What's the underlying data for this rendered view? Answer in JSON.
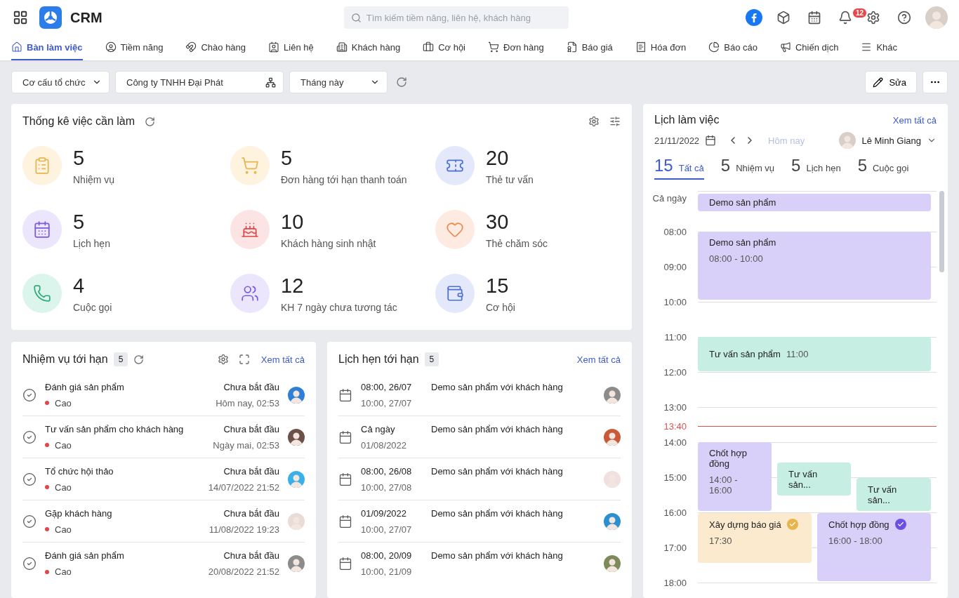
{
  "header": {
    "app_name": "CRM",
    "search": {
      "placeholder": "Tìm kiếm tiềm năng, liên hệ, khách hàng"
    },
    "notifications": "12"
  },
  "nav": [
    {
      "label": "Bàn làm việc",
      "kind": "home",
      "selected": true
    },
    {
      "label": "Tiềm năng",
      "kind": "lead",
      "selected": false
    },
    {
      "label": "Chào hàng",
      "kind": "magnet",
      "selected": false
    },
    {
      "label": "Liên hệ",
      "kind": "contact",
      "selected": false
    },
    {
      "label": "Khách hàng",
      "kind": "building",
      "selected": false
    },
    {
      "label": "Cơ hội",
      "kind": "wallet",
      "selected": false
    },
    {
      "label": "Đơn hàng",
      "kind": "cart",
      "selected": false
    },
    {
      "label": "Báo giá",
      "kind": "quote",
      "selected": false
    },
    {
      "label": "Hóa đơn",
      "kind": "invoice",
      "selected": false
    },
    {
      "label": "Báo cáo",
      "kind": "report",
      "selected": false
    },
    {
      "label": "Chiến dịch",
      "kind": "campaign",
      "selected": false
    },
    {
      "label": "Khác",
      "kind": "more",
      "selected": false
    }
  ],
  "filters": {
    "org": "Cơ cấu tổ chức",
    "company": "Công ty TNHH Đại Phát",
    "period": "Tháng này",
    "edit": "Sửa"
  },
  "stats": {
    "title": "Thống kê việc cần làm",
    "items": [
      {
        "value": "5",
        "label": "Nhiệm vụ",
        "kind": "task",
        "color": "#fdf3df"
      },
      {
        "value": "5",
        "label": "Đơn hàng tới hạn thanh toán",
        "kind": "cart",
        "color": "#fdf3df"
      },
      {
        "value": "20",
        "label": "Thẻ tư vấn",
        "kind": "ticket",
        "color": "#e3e8fb"
      },
      {
        "value": "5",
        "label": "Lịch hẹn",
        "kind": "calendar",
        "color": "#ebe6fb"
      },
      {
        "value": "10",
        "label": "Khách hàng sinh nhật",
        "kind": "cake",
        "color": "#fde4e4"
      },
      {
        "value": "30",
        "label": "Thẻ chăm sóc",
        "kind": "heart",
        "color": "#fdebe2"
      },
      {
        "value": "4",
        "label": "Cuộc gọi",
        "kind": "phone",
        "color": "#dcf5ec"
      },
      {
        "value": "12",
        "label": "KH 7 ngày chưa tương tác",
        "kind": "users",
        "color": "#ebe6fb"
      },
      {
        "value": "15",
        "label": "Cơ hội",
        "kind": "wallet",
        "color": "#e3e8fb"
      }
    ]
  },
  "tasks": {
    "title": "Nhiệm vụ tới hạn",
    "count": "5",
    "view_all": "Xem tất cả",
    "rows": [
      {
        "title": "Đánh giá sản phẩm",
        "priority": "Cao",
        "color": "#e04848",
        "status": "Chưa bắt đầu",
        "due": "Hôm nay, 02:53"
      },
      {
        "title": "Tư vấn sản phẩm cho khách hàng",
        "priority": "Cao",
        "color": "#e04848",
        "status": "Chưa bắt đầu",
        "due": "Ngày mai, 02:53"
      },
      {
        "title": "Tổ chức hội thảo",
        "priority": "Cao",
        "color": "#e04848",
        "status": "Chưa bắt đầu",
        "due": "14/07/2022 21:52"
      },
      {
        "title": "Gặp khách hàng",
        "priority": "Cao",
        "color": "#e04848",
        "status": "Chưa bắt đầu",
        "due": "11/08/2022 19:23"
      },
      {
        "title": "Đánh giá sản phẩm",
        "priority": "Cao",
        "color": "#e04848",
        "status": "Chưa bắt đầu",
        "due": "20/08/2022 21:52"
      }
    ]
  },
  "appointments": {
    "title": "Lịch hẹn tới hạn",
    "count": "5",
    "view_all": "Xem tất cả",
    "rows": [
      {
        "start": "08:00, 26/07",
        "end": "10:00, 27/07",
        "title": "Demo sản phẩm với khách hàng"
      },
      {
        "start": "Cả ngày",
        "end": "01/08/2022",
        "title": "Demo sản phẩm với khách hàng"
      },
      {
        "start": "08:00, 26/08",
        "end": "10:00, 27/08",
        "title": "Demo sản phẩm với khách hàng"
      },
      {
        "start": "01/09/2022",
        "end": "10:00, 27/07",
        "title": "Demo sản phẩm với khách hàng"
      },
      {
        "start": "08:00, 20/09",
        "end": "10:00, 21/09",
        "title": "Demo sản phẩm với khách hàng"
      }
    ]
  },
  "schedule": {
    "title": "Lịch làm việc",
    "view_all": "Xem tất cả",
    "date": "21/11/2022",
    "today": "Hôm nay",
    "user": "Lê Minh Giang",
    "tabs": [
      {
        "count": "15",
        "label": "Tất cả",
        "selected": true
      },
      {
        "count": "5",
        "label": "Nhiệm vụ",
        "selected": false
      },
      {
        "count": "5",
        "label": "Lịch hẹn",
        "selected": false
      },
      {
        "count": "5",
        "label": "Cuộc gọi",
        "selected": false
      }
    ],
    "all_day_label": "Cả ngày",
    "hours": [
      "08:00",
      "09:00",
      "10:00",
      "11:00",
      "12:00",
      "13:00",
      "14:00",
      "15:00",
      "16:00",
      "17:00",
      "18:00"
    ],
    "now": "13:40",
    "events": [
      {
        "title": "Demo sản phẩm",
        "kind": "meeting",
        "done": false
      },
      {
        "title": "Demo sản phẩm",
        "time": "08:00 - 10:00",
        "kind": "meeting",
        "done": false
      },
      {
        "title": "Tư vấn sản phẩm",
        "time": "11:00",
        "kind": "consult",
        "done": false
      },
      {
        "title": "Chốt hợp đồng",
        "time": "14:00 - 16:00",
        "kind": "meeting",
        "done": false
      },
      {
        "title": "Tư vấn sản...",
        "kind": "consult",
        "done": false
      },
      {
        "title": "Tư vấn sản...",
        "kind": "consult",
        "done": false
      },
      {
        "title": "Xây dựng báo giá",
        "time": "17:30",
        "kind": "task",
        "done": true
      },
      {
        "title": "Chốt hợp đồng",
        "time": "16:00 - 18:00",
        "kind": "meeting",
        "done": true
      }
    ]
  }
}
